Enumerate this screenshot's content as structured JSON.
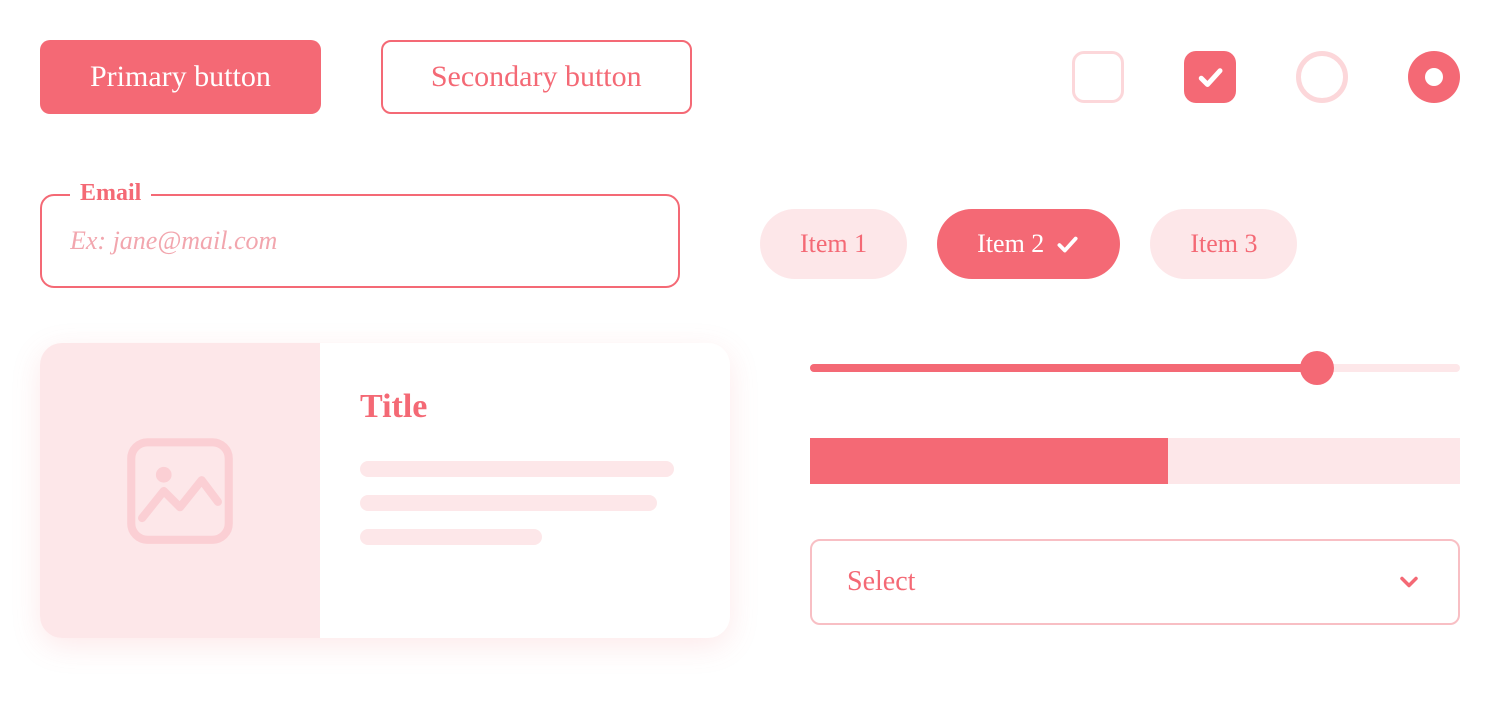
{
  "buttons": {
    "primary": "Primary button",
    "secondary": "Secondary button"
  },
  "toggles": {
    "checkbox_unchecked": false,
    "checkbox_checked": true,
    "radio_unchecked": false,
    "radio_checked": true
  },
  "email": {
    "label": "Email",
    "placeholder": "Ex: jane@mail.com",
    "value": ""
  },
  "pills": {
    "items": [
      {
        "label": "Item 1",
        "selected": false
      },
      {
        "label": "Item 2",
        "selected": true
      },
      {
        "label": "Item 3",
        "selected": false
      }
    ]
  },
  "card": {
    "title": "Title"
  },
  "slider": {
    "percent": 78
  },
  "progress": {
    "percent": 55
  },
  "select": {
    "placeholder": "Select"
  },
  "colors": {
    "accent": "#f46975",
    "pale": "#fcd7da",
    "paler": "#fde7e9"
  }
}
